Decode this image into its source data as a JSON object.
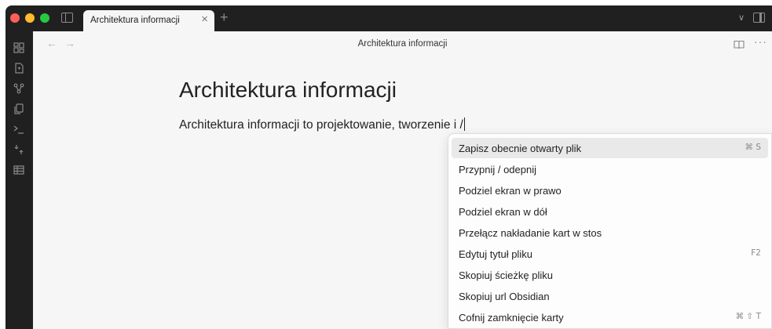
{
  "tabs": [
    {
      "label": "Architektura informacji",
      "active": true
    }
  ],
  "view_header": {
    "title": "Architektura informacji"
  },
  "editor": {
    "title": "Architektura informacji",
    "line": "Architektura informacji to projektowanie, tworzenie i /"
  },
  "commands": [
    {
      "label": "Zapisz obecnie otwarty plik",
      "hotkey": "⌘ S",
      "selected": true
    },
    {
      "label": "Przypnij / odepnij",
      "hotkey": ""
    },
    {
      "label": "Podziel ekran w prawo",
      "hotkey": ""
    },
    {
      "label": "Podziel ekran w dół",
      "hotkey": ""
    },
    {
      "label": "Przełącz nakładanie kart w stos",
      "hotkey": ""
    },
    {
      "label": "Edytuj tytuł pliku",
      "hotkey": "F2"
    },
    {
      "label": "Skopiuj ścieżkę pliku",
      "hotkey": ""
    },
    {
      "label": "Skopiuj url Obsidian",
      "hotkey": ""
    },
    {
      "label": "Cofnij zamknięcie karty",
      "hotkey": "⌘ ⇧ T"
    }
  ],
  "ribbon": [
    "switcher-icon",
    "daily-note-icon",
    "graph-icon",
    "templates-icon",
    "command-palette-icon",
    "importer-icon",
    "canvas-icon"
  ],
  "colors": {
    "titlebar": "#202020",
    "editor_bg": "#f6f6f6",
    "selected_item": "#e9e9e9",
    "close_dot": "#fe5f57",
    "minimize_dot": "#febc2e",
    "zoom_dot": "#28c840"
  }
}
